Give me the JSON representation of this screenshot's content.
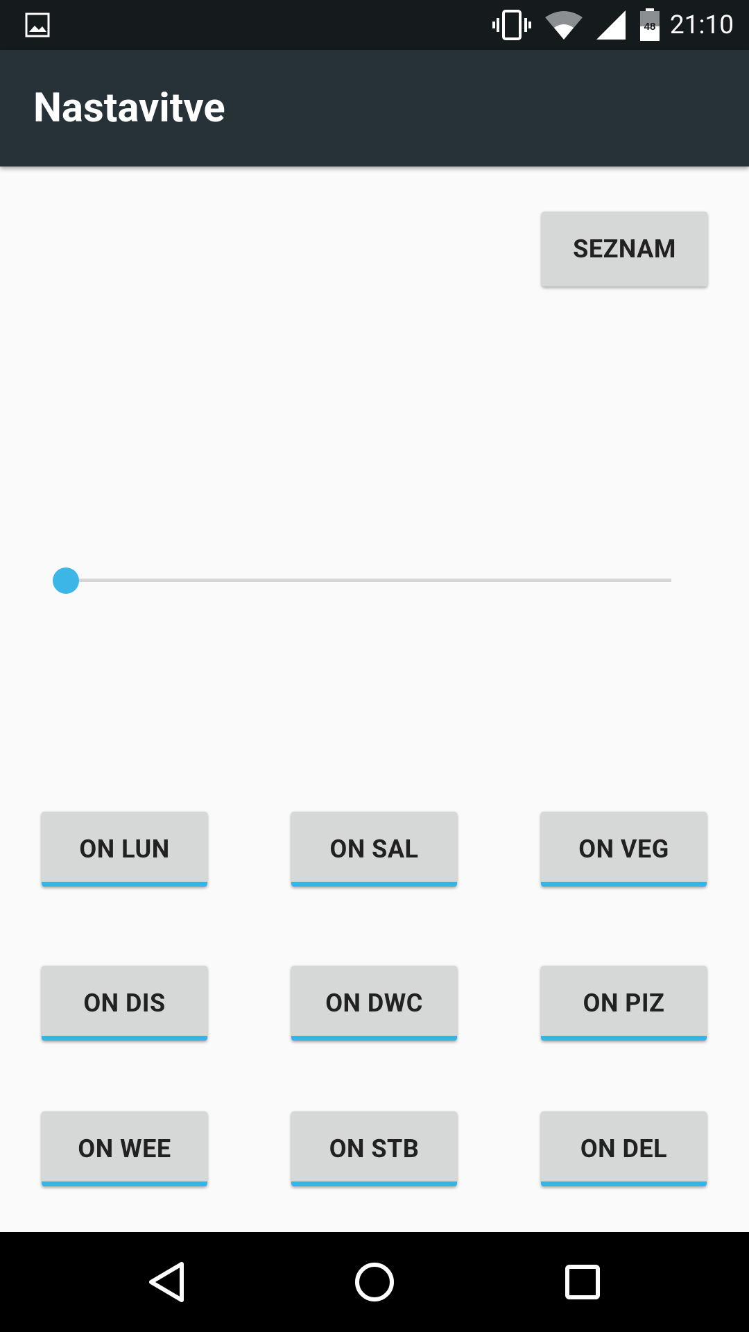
{
  "status_bar": {
    "time": "21:10",
    "battery_level": "48",
    "icons": [
      "image-notification-icon",
      "vibrate-icon",
      "wifi-icon",
      "cell-signal-icon",
      "battery-icon"
    ]
  },
  "app_bar": {
    "title": "Nastavitve"
  },
  "seznam_button": {
    "label": "SEZNAM"
  },
  "seekbar": {
    "value": 0,
    "max": 100,
    "accent": "#33b5e5"
  },
  "toggles": [
    {
      "label": "ON LUN"
    },
    {
      "label": "ON SAL"
    },
    {
      "label": "ON VEG"
    },
    {
      "label": "ON DIS"
    },
    {
      "label": "ON DWC"
    },
    {
      "label": "ON PIZ"
    },
    {
      "label": "ON WEE"
    },
    {
      "label": "ON STB"
    },
    {
      "label": "ON DEL"
    }
  ],
  "nav_bar": {
    "icons": [
      "back-icon",
      "home-icon",
      "recents-icon"
    ]
  },
  "colors": {
    "status_bar": "#151a1d",
    "app_bar": "#263238",
    "background": "#fafafa",
    "button": "#d6d7d7",
    "accent": "#33b5e5"
  }
}
